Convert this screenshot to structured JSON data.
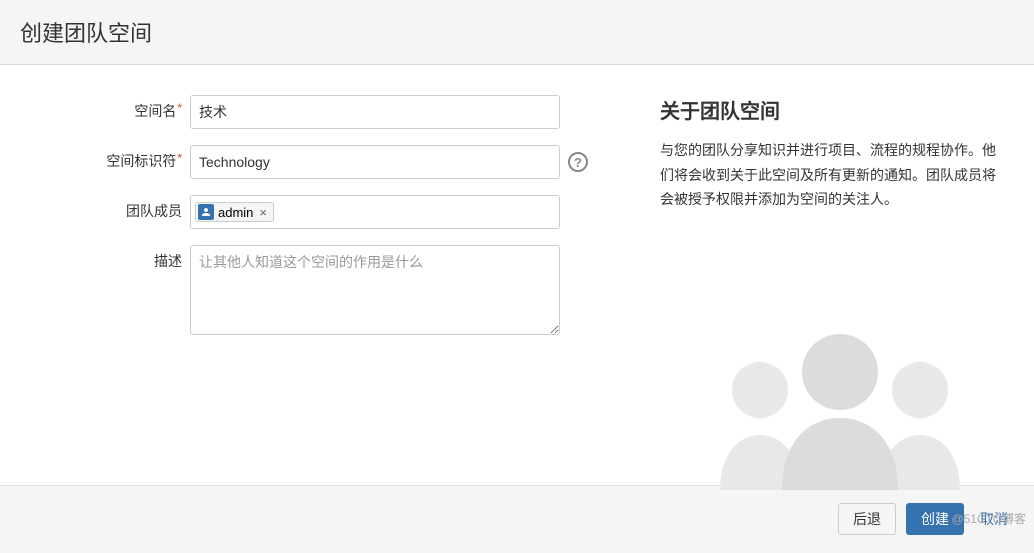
{
  "header": {
    "title": "创建团队空间"
  },
  "form": {
    "space_name": {
      "label": "空间名",
      "value": "技术"
    },
    "space_id": {
      "label": "空间标识符",
      "value": "Technology"
    },
    "members": {
      "label": "团队成员",
      "tags": [
        {
          "name": "admin"
        }
      ]
    },
    "description": {
      "label": "描述",
      "placeholder": "让其他人知道这个空间的作用是什么",
      "value": ""
    }
  },
  "info": {
    "heading": "关于团队空间",
    "body": "与您的团队分享知识并进行项目、流程的规程协作。他们将会收到关于此空间及所有更新的通知。团队成员将会被授予权限并添加为空间的关注人。"
  },
  "footer": {
    "back": "后退",
    "create": "创建",
    "cancel": "取消"
  },
  "watermark": "@51CTO博客"
}
